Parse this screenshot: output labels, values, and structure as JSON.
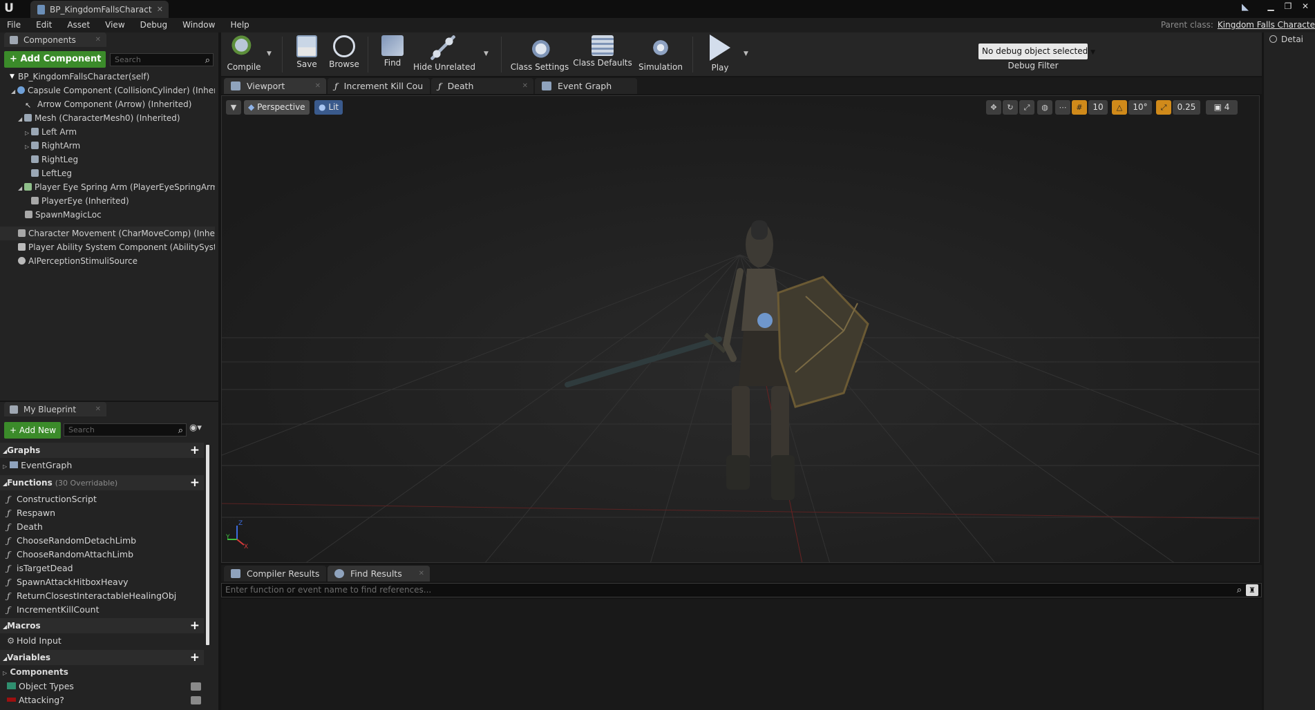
{
  "window": {
    "doc_tab": "BP_KingdomFallsCharact",
    "parent_class_label": "Parent class:",
    "parent_class_value": "Kingdom Falls Characte"
  },
  "menu": [
    "File",
    "Edit",
    "Asset",
    "View",
    "Debug",
    "Window",
    "Help"
  ],
  "components_panel": {
    "tab": "Components",
    "add_button": "Add Component",
    "search_placeholder": "Search",
    "items": [
      "BP_KingdomFallsCharacter(self)",
      "Capsule Component (CollisionCylinder) (Inherited",
      "Arrow Component (Arrow) (Inherited)",
      "Mesh (CharacterMesh0) (Inherited)",
      "Left Arm",
      "RightArm",
      "RightLeg",
      "LeftLeg",
      "Player Eye Spring Arm (PlayerEyeSpringArm) (In",
      "PlayerEye (Inherited)",
      "SpawnMagicLoc",
      "Character Movement (CharMoveComp) (Inherited)",
      "Player Ability System Component (AbilitySystemC",
      "AIPerceptionStimuliSource"
    ]
  },
  "my_blueprint": {
    "tab": "My Blueprint",
    "add_button": "Add New",
    "search_placeholder": "Search",
    "graphs_header": "Graphs",
    "graphs": [
      "EventGraph"
    ],
    "functions_header": "Functions",
    "functions_count": "(30 Overridable)",
    "functions": [
      "ConstructionScript",
      "Respawn",
      "Death",
      "ChooseRandomDetachLimb",
      "ChooseRandomAttachLimb",
      "isTargetDead",
      "SpawnAttackHitboxHeavy",
      "ReturnClosestInteractableHealingObj",
      "IncrementKillCount"
    ],
    "macros_header": "Macros",
    "macros": [
      "Hold Input"
    ],
    "variables_header": "Variables",
    "variables_sub": "Components",
    "variables": [
      "Object Types",
      "Attacking?"
    ]
  },
  "toolbar": {
    "compile": "Compile",
    "save": "Save",
    "browse": "Browse",
    "find": "Find",
    "hide_unrelated": "Hide Unrelated",
    "class_settings": "Class Settings",
    "class_defaults": "Class Defaults",
    "simulation": "Simulation",
    "play": "Play",
    "debug_select": "No debug object selected",
    "debug_filter": "Debug Filter"
  },
  "editor_tabs": [
    "Viewport",
    "Increment Kill Cou",
    "Death",
    "Event Graph"
  ],
  "viewport": {
    "perspective": "Perspective",
    "lit": "Lit",
    "grid_snap": "10",
    "rot_snap": "10°",
    "scale_snap": "0.25",
    "cam_speed": "4",
    "axis_x": "X",
    "axis_y": "Y",
    "axis_z": "Z"
  },
  "bottom_tabs": [
    "Compiler Results",
    "Find Results"
  ],
  "find_placeholder": "Enter function or event name to find references...",
  "details_tab": "Detai",
  "colors": {
    "accent_green": "#3b8b2a",
    "toolbar_bg": "#262626",
    "panel_bg": "#232323"
  }
}
